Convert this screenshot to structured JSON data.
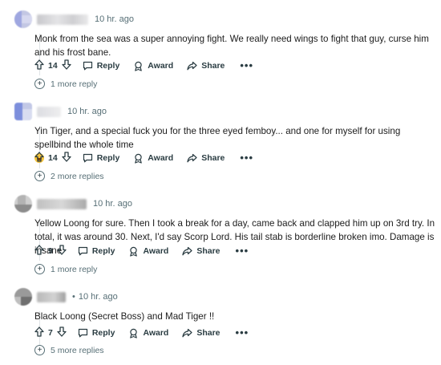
{
  "comments": [
    {
      "time": "10 hr. ago",
      "text": "Monk from the sea was a super annoying fight. We really need wings to fight that guy, curse him and his frost bane.",
      "votes": "14",
      "reply_label": "Reply",
      "award_label": "Award",
      "share_label": "Share",
      "more_replies": "1 more reply"
    },
    {
      "time": "10 hr. ago",
      "text": "Yin Tiger, and a special fuck you for the three eyed femboy... and one for myself for using spellbind the whole time",
      "votes": "14",
      "reply_label": "Reply",
      "award_label": "Award",
      "share_label": "Share",
      "more_replies": "2 more replies"
    },
    {
      "time": "10 hr. ago",
      "text": "Yellow Loong for sure. Then I took a break for a day, came back and clapped him up on 3rd try. In total, it was around 30. Next, I'd say Scorp Lord. His tail stab is borderline broken imo. Damage is insane",
      "votes": "9",
      "reply_label": "Reply",
      "award_label": "Award",
      "share_label": "Share",
      "more_replies": "1 more reply"
    },
    {
      "time": "10 hr. ago",
      "time_prefix": "•",
      "text": "Black Loong (Secret Boss) and Mad Tiger !!",
      "votes": "7",
      "reply_label": "Reply",
      "award_label": "Award",
      "share_label": "Share",
      "more_replies": "5 more replies"
    }
  ],
  "icons": {
    "upvote": "upvote-arrow-icon",
    "downvote": "downvote-arrow-icon",
    "reply": "speech-bubble-icon",
    "award": "award-medal-icon",
    "share": "share-arrow-icon",
    "more": "ellipsis-icon",
    "expand": "plus-circle-icon"
  },
  "colors": {
    "text": "#1c1c1c",
    "meta": "#576f76",
    "actions": "#2a3c42",
    "thread_line": "#e0e4e6"
  }
}
